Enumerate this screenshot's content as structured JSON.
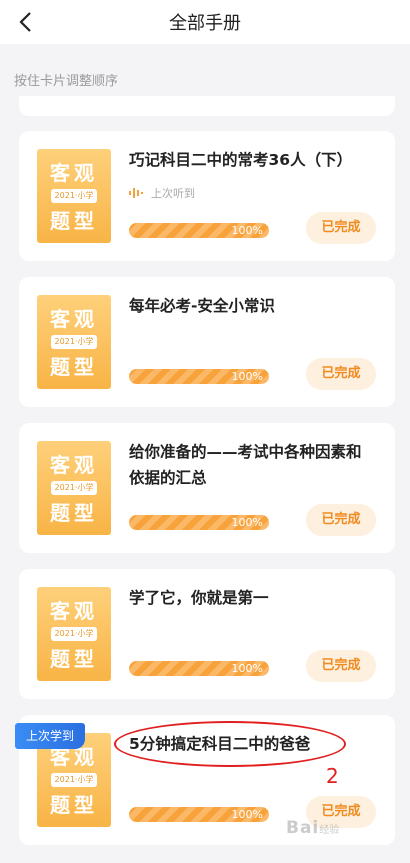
{
  "header": {
    "title": "全部手册"
  },
  "hint": "按住卡片调整顺序",
  "cover": {
    "line1": "客观",
    "tag": "2021·小学",
    "line2": "题型"
  },
  "cards": [
    {
      "title": "巧记科目二中的常考36人（下）",
      "meta": "上次听到",
      "progress_label": "100%",
      "progress": 1.0,
      "status": "已完成"
    },
    {
      "title": "每年必考-安全小常识",
      "progress_label": "100%",
      "progress": 1.0,
      "status": "已完成"
    },
    {
      "title": "给你准备的——考试中各种因素和依据的汇总",
      "progress_label": "100%",
      "progress": 1.0,
      "status": "已完成"
    },
    {
      "title": "学了它，你就是第一",
      "progress_label": "100%",
      "progress": 1.0,
      "status": "已完成"
    },
    {
      "title": "5分钟搞定科目二中的爸爸",
      "badge": "上次学到",
      "progress_label": "100%",
      "progress": 1.0,
      "status": "已完成"
    }
  ],
  "annotation": {
    "number": "2"
  },
  "watermark": {
    "text": "Bai",
    "sub": "经验"
  },
  "colors": {
    "accent": "#f7a23b",
    "done_bg": "#fdf0de",
    "done_text": "#f08b22",
    "badge": "#2b6fe1",
    "annotation": "#e02020"
  }
}
